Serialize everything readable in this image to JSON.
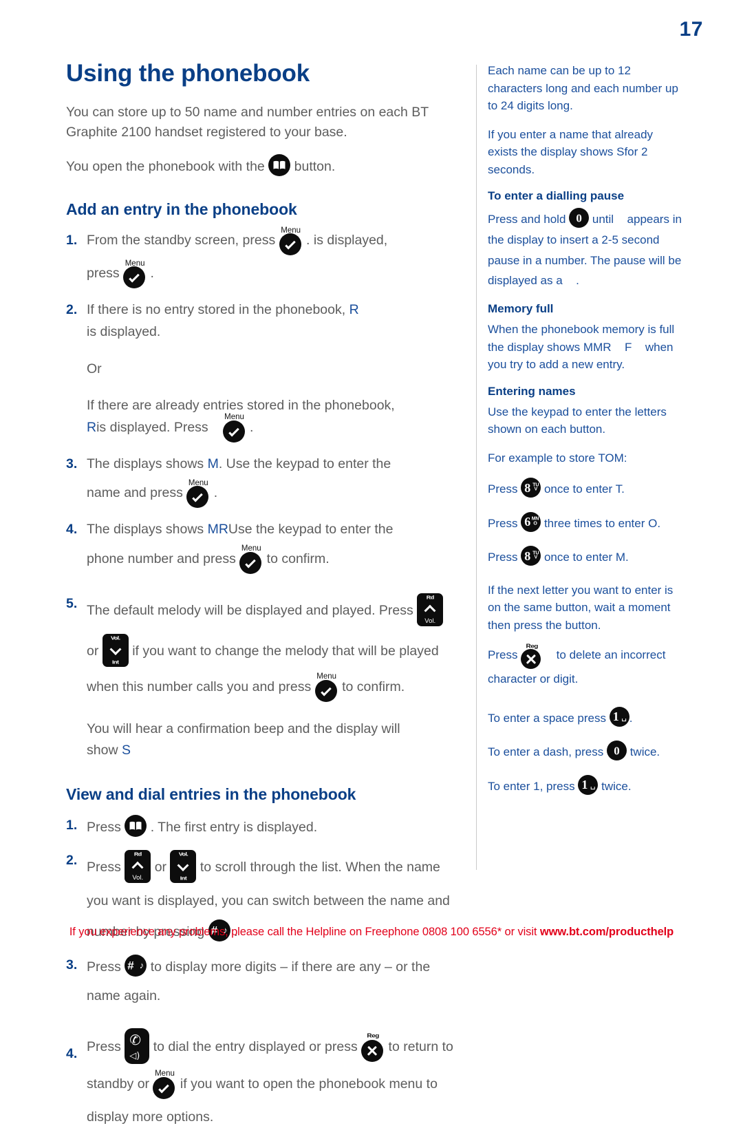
{
  "page": {
    "number": "17"
  },
  "left": {
    "title": "Using the phonebook",
    "intro1": "You can store up to 50 name and number entries on each BT Graphite 2100 handset registered to your base.",
    "intro2_a": "You open the phonebook with the",
    "intro2_b": "button.",
    "heading_add": "Add an entry in the phonebook",
    "steps_add": [
      {
        "num": "1.",
        "a": "From the standby screen, press",
        "b": ". ",
        "c": "is displayed,",
        "d": "press",
        "e": "."
      },
      {
        "num": "2.",
        "a": "If there is no entry stored in the phonebook,",
        "code": "R",
        "b": "is displayed.",
        "or": "Or",
        "c": "If there are already entries stored in the phonebook,",
        "code2": "R",
        "d": "is displayed. Press",
        "e": "."
      },
      {
        "num": "3.",
        "a": "The displays shows",
        "code": "M",
        "b": ". Use the keypad to enter the",
        "c": "name and press",
        "d": "."
      },
      {
        "num": "4.",
        "a": "The displays shows",
        "code": "MR",
        "b": "Use the keypad to enter the",
        "c": "phone number and press",
        "d": "to confirm."
      },
      {
        "num": "5.",
        "a": "The default melody will be displayed and played. Press",
        "b": "or",
        "c": "if you want to change the melody that will be played",
        "d": "when this number calls you and press",
        "e": "to confirm.",
        "f": "You will hear a confirmation beep and the display will",
        "g": "show",
        "code": "S"
      }
    ],
    "heading_view": "View and dial entries in the phonebook",
    "steps_view": [
      {
        "num": "1.",
        "a": "Press",
        "b": ". The first entry is displayed."
      },
      {
        "num": "2.",
        "a": "Press",
        "b": "or",
        "c": "to scroll through the list. When the name",
        "d": "you want is displayed, you can switch between the name and",
        "e": "number by pressing",
        "f": "."
      },
      {
        "num": "3.",
        "a": "Press",
        "b": "to display more digits – if there are any – or the",
        "c": "name again."
      },
      {
        "num": "4.",
        "a": "Press",
        "b": "to dial the entry displayed or press",
        "c": "to return to",
        "d": "standby or",
        "e": "if you want to open the phonebook menu to",
        "f": "display more options."
      }
    ]
  },
  "right": {
    "p1": "Each name can be up to 12 characters long and each number up to 24 digits long.",
    "p2_a": "If you enter a name that already exists the display shows",
    "p2_code": "S",
    "p2_b": "for 2 seconds.",
    "h1": "To enter a dialling pause",
    "p3_a": "Press and hold",
    "p3_b": "until",
    "p3_c": "appears in the display to insert a 2-5 second pause in a number. The pause will be displayed as a",
    "p3_d": ".",
    "h2": "Memory full",
    "p4_a": "When the phonebook memory is full the display shows MMR",
    "p4_b": "F",
    "p4_c": "when you try to add a new entry.",
    "h3": "Entering names",
    "p5": "Use the keypad to enter the letters shown on each button.",
    "p6": "For example to store TOM:",
    "p7_a": "Press",
    "p7_b": "once to enter T.",
    "p8_a": "Press",
    "p8_b": "three times to enter O.",
    "p9_a": "Press",
    "p9_b": "once to enter M.",
    "p10": "If the next letter you want to enter is on the same button, wait a moment then press the button.",
    "p11_a": "Press",
    "p11_b": "to delete an incorrect character or digit.",
    "p12_a": "To enter a space press",
    "p12_b": ".",
    "p13_a": "To enter a dash, press",
    "p13_b": "twice.",
    "p14_a": "To enter 1, press",
    "p14_b": "twice."
  },
  "icons": {
    "menu_label": "Menu",
    "reg_label": "Reg",
    "vol_label": "Vol.",
    "redial_label": "Rd",
    "intercom_label": "Int",
    "key_0": "0",
    "key_1": "1",
    "key_6": "6",
    "key_8": "8",
    "key_6_letters_top": "MN",
    "key_6_letters_bot": "O",
    "key_8_letters_top": "TU",
    "key_8_letters_bot": "V",
    "hash": "#",
    "music_note": "♪",
    "space_symbol": "␣",
    "handset": "✆",
    "speaker": "◁)",
    "book": "open-book"
  },
  "footer": {
    "text_a": "If you experience any problems, please call the Helpline on Freephone 0808 100 6556* or visit ",
    "url": "www.bt.com/producthelp"
  },
  "colors": {
    "heading_blue": "#0a3f86",
    "body_grey": "#5d5d5d",
    "right_blue": "#1b4f9c",
    "footer_red": "#e2001a",
    "key_black": "#0d0d0d"
  }
}
